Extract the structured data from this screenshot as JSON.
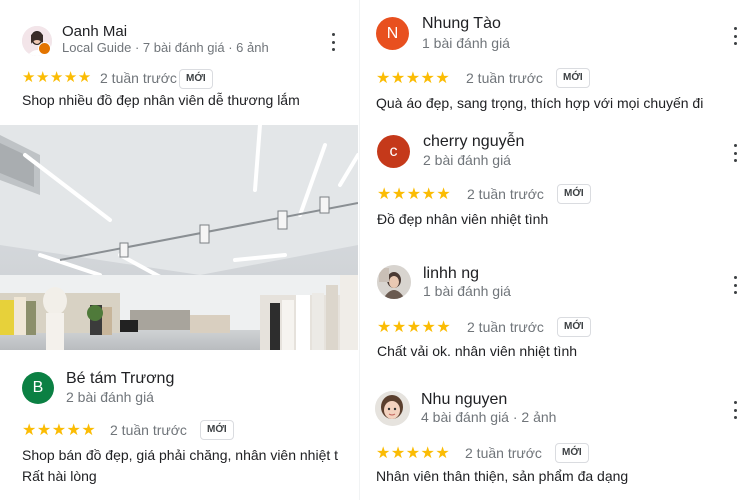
{
  "new_badge": "MỚI",
  "star_color": "#fbbc04",
  "left_reviews": [
    {
      "name": "Oanh Mai",
      "meta": "Local Guide · 7 bài đánh giá · 6 ảnh",
      "avatar": "profile-photo",
      "rating": 5,
      "time": "2 tuần trước",
      "text_lines": [
        "Shop nhiều đồ đẹp nhân viên dễ thương lắm"
      ],
      "photo": "store-interior-photo"
    },
    {
      "name": "Bé tám Trương",
      "meta": "2 bài đánh giá",
      "avatar_letter": "B",
      "avatar_color": "#0b8043",
      "rating": 5,
      "time": "2 tuần trước",
      "text_lines": [
        "Shop bán đồ đẹp, giá phải chăng, nhân viên nhiệt t",
        "Rất hài lòng"
      ]
    }
  ],
  "right_reviews": [
    {
      "name": "Nhung Tào",
      "meta": "1 bài đánh giá",
      "avatar_letter": "N",
      "avatar_color": "#e8501f",
      "rating": 5,
      "time": "2 tuần trước",
      "text_lines": [
        "Quà áo đẹp, sang trọng, thích hợp với mọi chuyến đi"
      ]
    },
    {
      "name": "cherry nguyễn",
      "meta": "2 bài đánh giá",
      "avatar_letter": "c",
      "avatar_color": "#c5391a",
      "rating": 5,
      "time": "2 tuần trước",
      "text_lines": [
        "Đồ đẹp nhân viên nhiệt tình"
      ]
    },
    {
      "name": "linhh ng",
      "meta": "1 bài đánh giá",
      "avatar": "profile-photo",
      "rating": 5,
      "time": "2 tuần trước",
      "text_lines": [
        "Chất vải ok. nhân viên nhiệt tình"
      ]
    },
    {
      "name": "Nhu nguyen",
      "meta": "4 bài đánh giá · 2 ảnh",
      "avatar": "profile-photo",
      "rating": 5,
      "time": "2 tuần trước",
      "text_lines": [
        "Nhân viên thân thiện, sản phẩm đa dạng"
      ]
    }
  ]
}
